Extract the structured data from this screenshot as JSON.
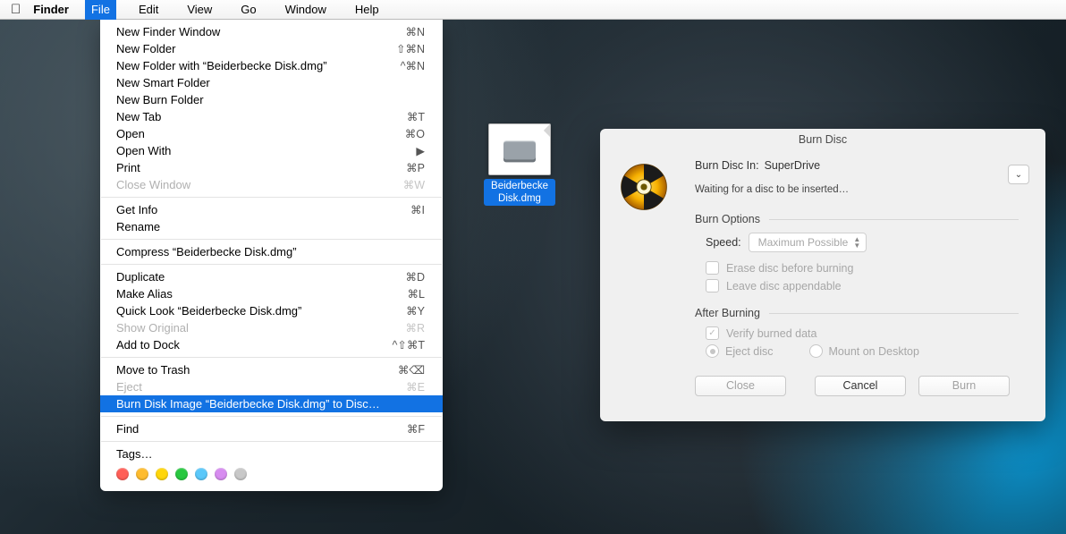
{
  "menubar": {
    "app": "Finder",
    "items": [
      {
        "label": "File",
        "selected": true
      },
      {
        "label": "Edit"
      },
      {
        "label": "View"
      },
      {
        "label": "Go"
      },
      {
        "label": "Window"
      },
      {
        "label": "Help"
      }
    ]
  },
  "file_menu": {
    "groups": [
      [
        {
          "label": "New Finder Window",
          "shortcut": "⌘N"
        },
        {
          "label": "New Folder",
          "shortcut": "⇧⌘N"
        },
        {
          "label": "New Folder with “Beiderbecke Disk.dmg”",
          "shortcut": "^⌘N"
        },
        {
          "label": "New Smart Folder"
        },
        {
          "label": "New Burn Folder"
        },
        {
          "label": "New Tab",
          "shortcut": "⌘T"
        },
        {
          "label": "Open",
          "shortcut": "⌘O"
        },
        {
          "label": "Open With",
          "shortcut": "▶"
        },
        {
          "label": "Print",
          "shortcut": "⌘P"
        },
        {
          "label": "Close Window",
          "shortcut": "⌘W",
          "disabled": true
        }
      ],
      [
        {
          "label": "Get Info",
          "shortcut": "⌘I"
        },
        {
          "label": "Rename"
        }
      ],
      [
        {
          "label": "Compress “Beiderbecke Disk.dmg”"
        }
      ],
      [
        {
          "label": "Duplicate",
          "shortcut": "⌘D"
        },
        {
          "label": "Make Alias",
          "shortcut": "⌘L"
        },
        {
          "label": "Quick Look “Beiderbecke Disk.dmg”",
          "shortcut": "⌘Y"
        },
        {
          "label": "Show Original",
          "shortcut": "⌘R",
          "disabled": true
        },
        {
          "label": "Add to Dock",
          "shortcut": "^⇧⌘T"
        }
      ],
      [
        {
          "label": "Move to Trash",
          "shortcut": "⌘⌫"
        },
        {
          "label": "Eject",
          "shortcut": "⌘E",
          "disabled": true
        },
        {
          "label": "Burn Disk Image “Beiderbecke Disk.dmg” to Disc…",
          "highlight": true
        }
      ],
      [
        {
          "label": "Find",
          "shortcut": "⌘F"
        }
      ],
      [
        {
          "label": "Tags…"
        }
      ]
    ],
    "tag_colors": [
      "#ff5f57",
      "#febc2e",
      "#ffd60a",
      "#28c840",
      "#5ac8fa",
      "#d78cf0",
      "#c8c8c8"
    ]
  },
  "desktop_icon": {
    "caption": "Beiderbecke Disk.dmg"
  },
  "dialog": {
    "title": "Burn Disc",
    "drive_label": "Burn Disc In:",
    "drive_value": "SuperDrive",
    "status": "Waiting for a disc to be inserted…",
    "options_header": "Burn Options",
    "speed_label": "Speed:",
    "speed_value": "Maximum Possible",
    "erase_label": "Erase disc before burning",
    "appendable_label": "Leave disc appendable",
    "after_header": "After Burning",
    "verify_label": "Verify burned data",
    "eject_label": "Eject disc",
    "mount_label": "Mount on Desktop",
    "close_btn": "Close",
    "cancel_btn": "Cancel",
    "burn_btn": "Burn"
  }
}
